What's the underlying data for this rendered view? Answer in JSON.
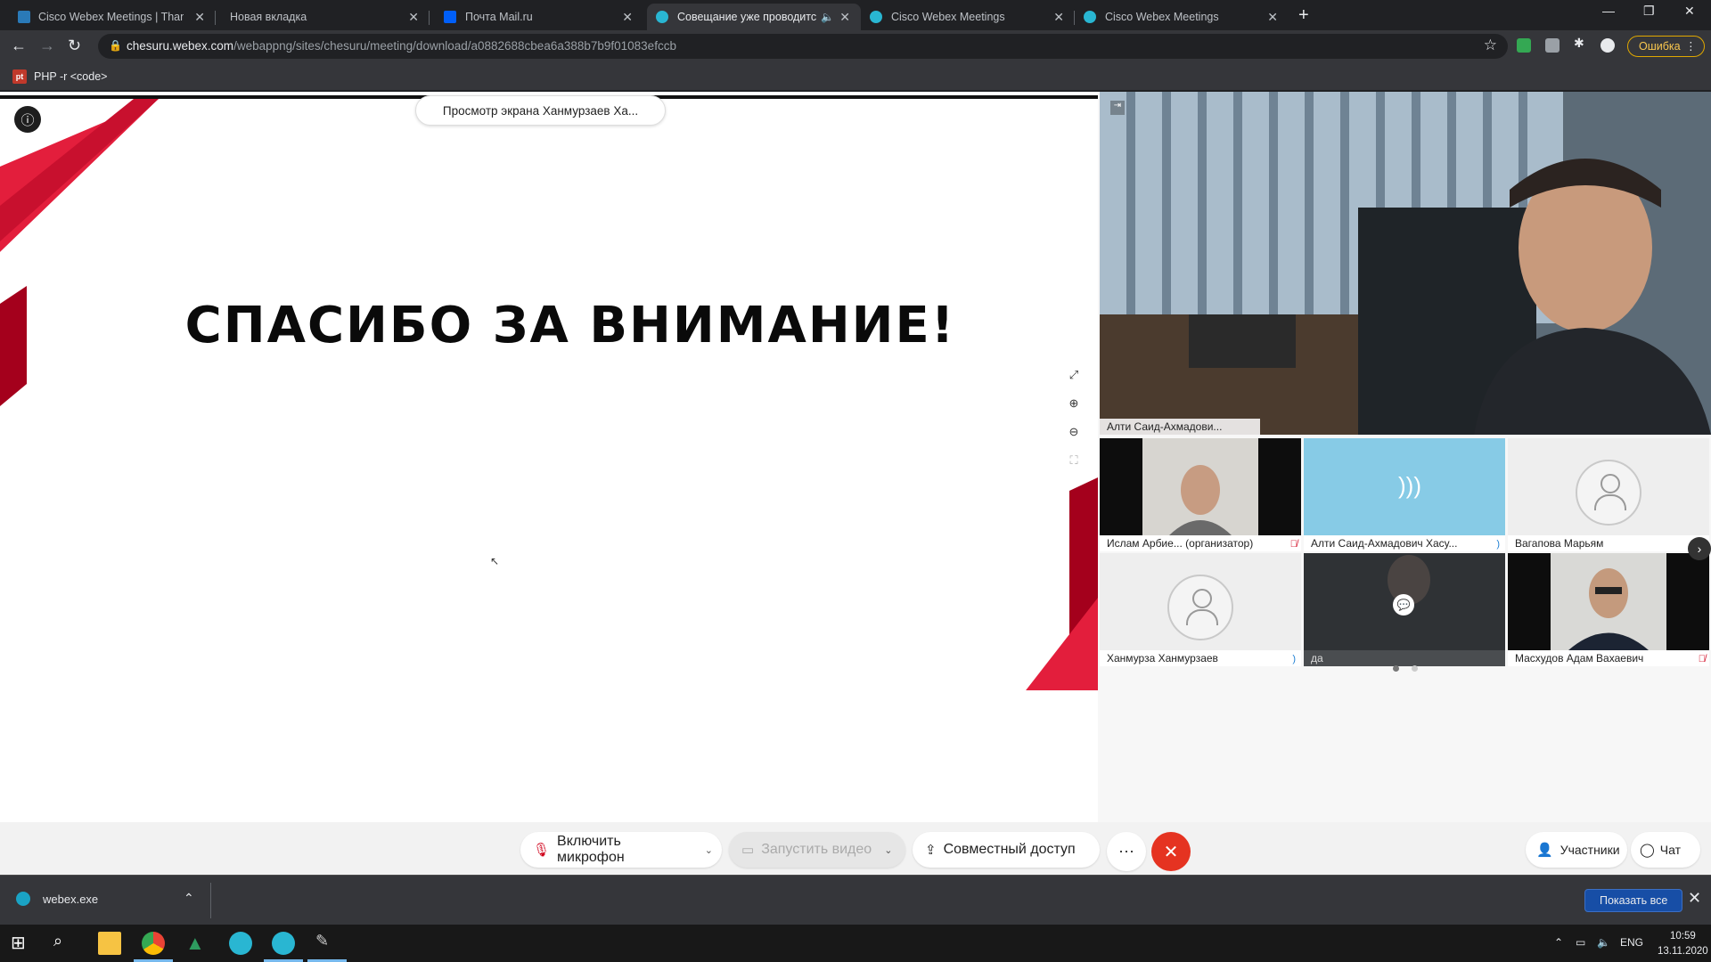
{
  "browser": {
    "tabs": [
      {
        "title": "Cisco Webex Meetings | Thank yo",
        "favicon_color": "#2a7ab8",
        "active": false
      },
      {
        "title": "Новая вкладка",
        "favicon_color": "",
        "active": false
      },
      {
        "title": "Почта Mail.ru",
        "favicon_color": "#005ff9",
        "active": false
      },
      {
        "title": "Совещание уже проводитс",
        "favicon_color": "#29b6d2",
        "active": true
      },
      {
        "title": "Cisco Webex Meetings",
        "favicon_color": "#29b6d2",
        "active": false
      },
      {
        "title": "Cisco Webex Meetings",
        "favicon_color": "#29b6d2",
        "active": false
      }
    ],
    "url_host": "chesuru.webex.com",
    "url_path": "/webappng/sites/chesuru/meeting/download/a0882688cbea6a388b7b9f01083efccb",
    "error_button": "Ошибка",
    "bookmark": "PHP -r <code>",
    "bookmark_icon": "pt"
  },
  "meeting": {
    "viewing_label": "Просмотр экрана Ханмурзаев Ха...",
    "slide_title": "СПАСИБО ЗА ВНИМАНИЕ!",
    "accent_color": "#e31e3c",
    "main_video_label": "Алти Саид-Ахмадови...",
    "participants": [
      {
        "name": "Ислам Арбие... (организатор)",
        "muted": true,
        "kind": "camera"
      },
      {
        "name": "Алти Саид-Ахмадович Хасу...",
        "muted": false,
        "kind": "speaking"
      },
      {
        "name": "Вагапова Марьям",
        "muted": false,
        "kind": "avatar"
      },
      {
        "name": "Ханмурза Ханмурзаев",
        "muted": false,
        "kind": "avatar"
      },
      {
        "name": "да",
        "muted": false,
        "kind": "camera-dark"
      },
      {
        "name": "Масхудов Адам Вахаевич",
        "muted": true,
        "kind": "camera"
      }
    ],
    "controls": {
      "mic": "Включить микрофон",
      "video": "Запустить видео",
      "share": "Совместный доступ",
      "participants": "Участники",
      "chat": "Чат"
    }
  },
  "downloads": {
    "file": "webex.exe",
    "show_all": "Показать все"
  },
  "taskbar": {
    "lang": "ENG",
    "time": "10:59",
    "date": "13.11.2020"
  }
}
